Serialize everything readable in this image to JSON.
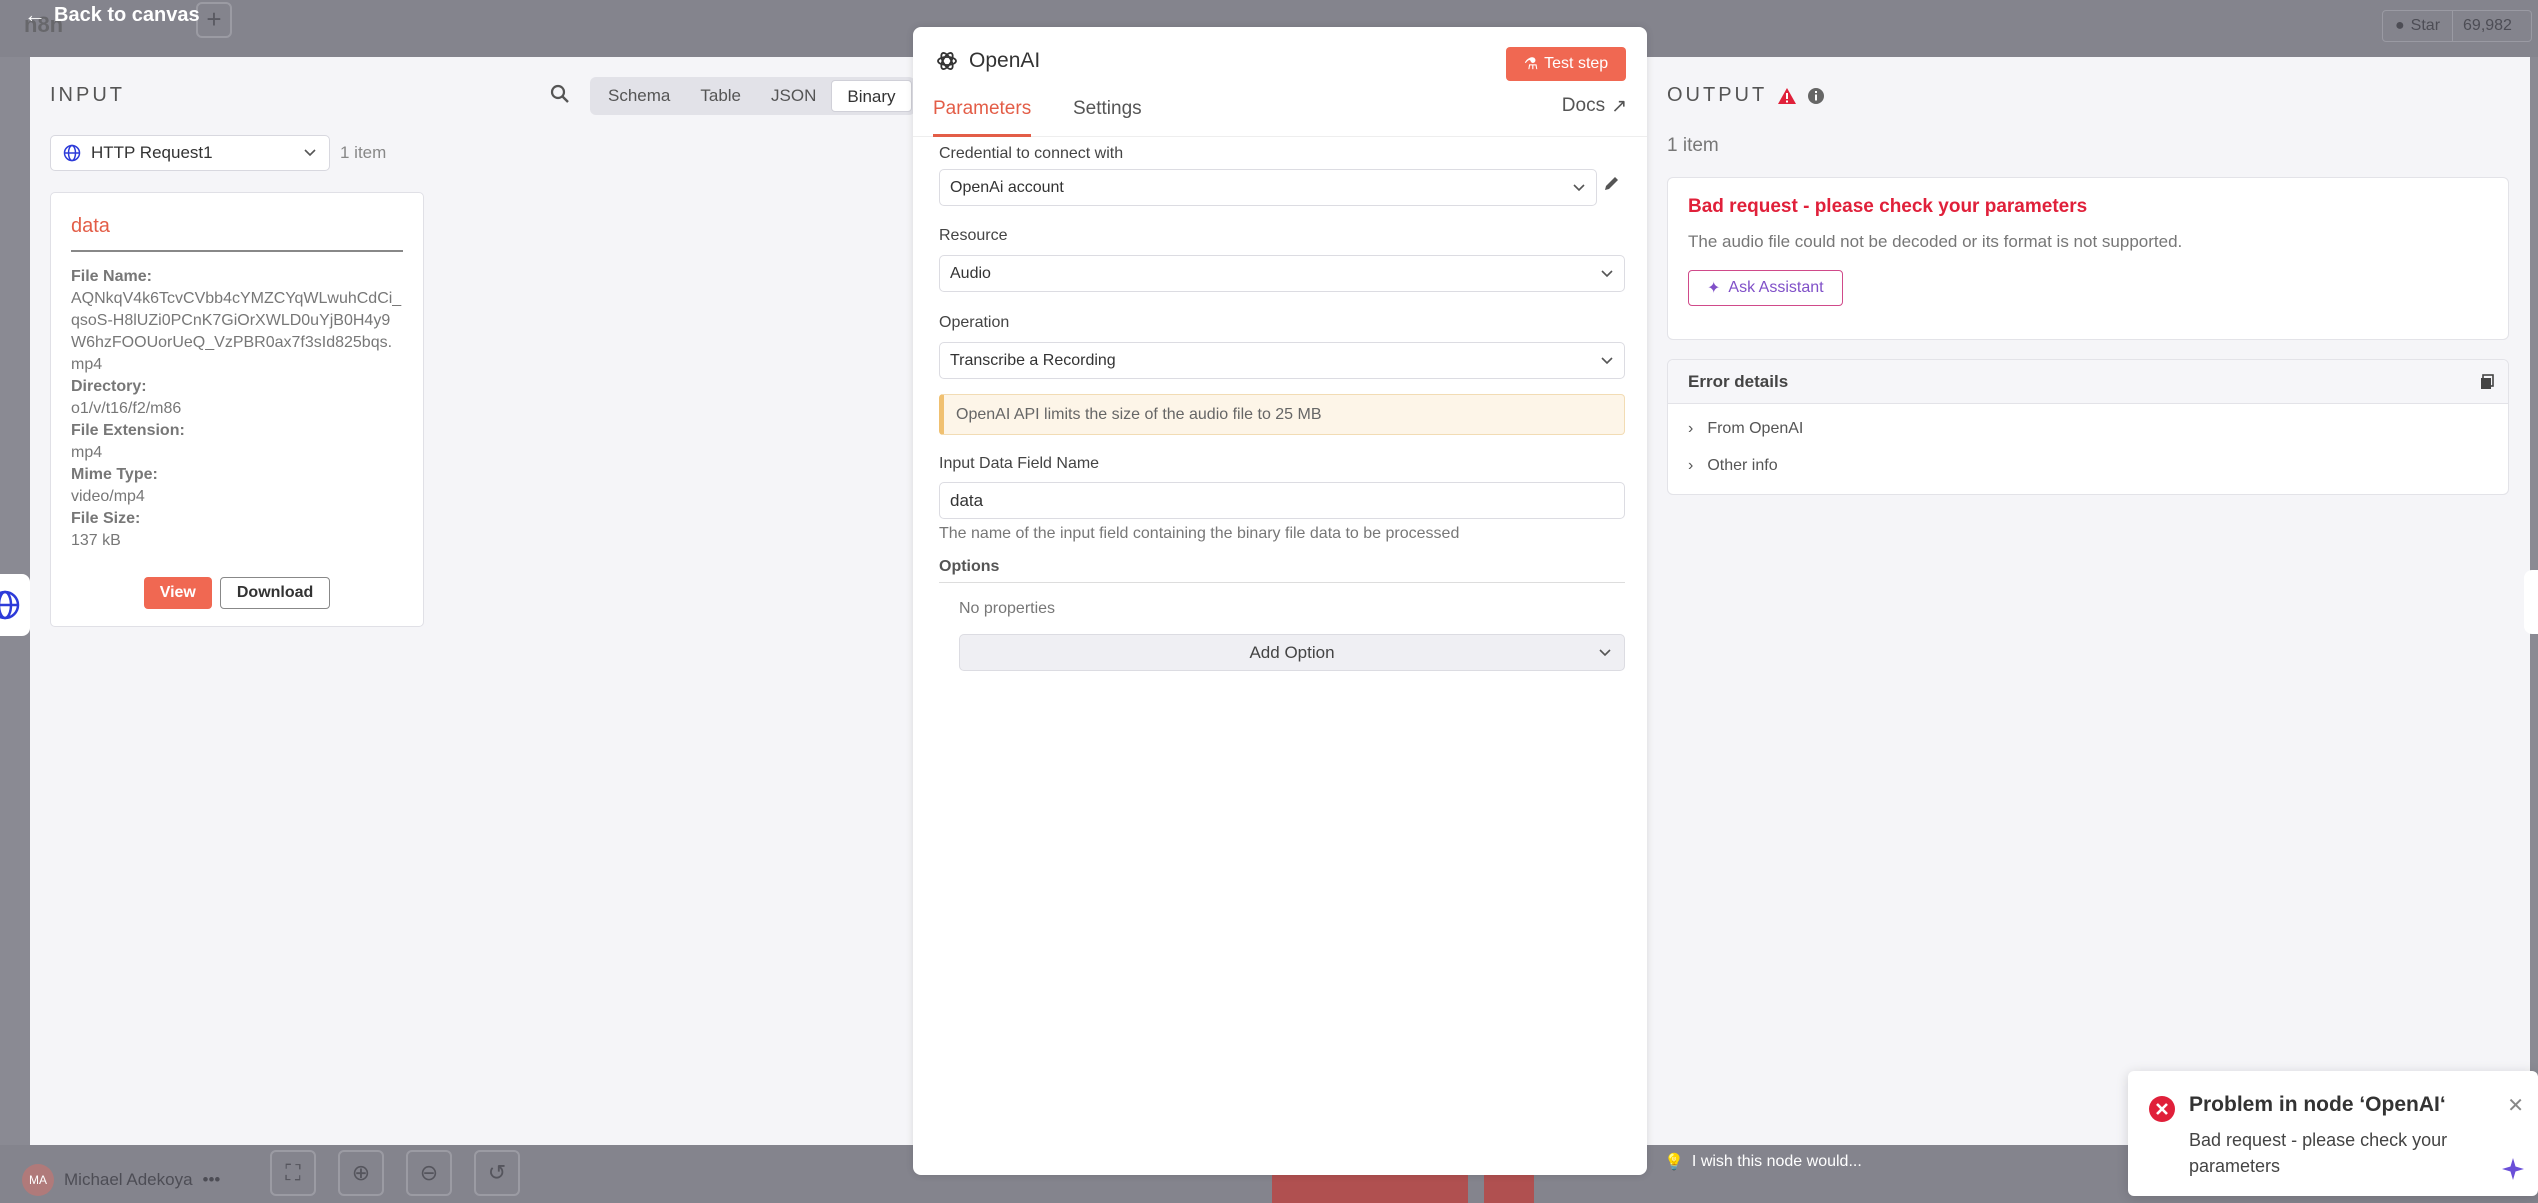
{
  "background": {
    "back_label": "Back to canvas",
    "logo": "n8n",
    "star_label": "Star",
    "star_count": "69,982",
    "user_initials": "MA",
    "user_name": "Michael Adekoya",
    "wish_text": "I wish this node would..."
  },
  "input": {
    "title": "INPUT",
    "tabs": [
      "Schema",
      "Table",
      "JSON",
      "Binary"
    ],
    "active_tab": "Binary",
    "node_name": "HTTP Request1",
    "item_count": "1 item",
    "card": {
      "title": "data",
      "fields": [
        {
          "label": "File Name:",
          "value": "AQNkqV4k6TcvCVbb4cYMZCYqWLwuhCdCi_qsoS-H8lUZi0PCnK7GiOrXWLD0uYjB0H4y9W6hzFOOUorUeQ_VzPBR0ax7f3sId825bqs.mp4"
        },
        {
          "label": "Directory:",
          "value": "o1/v/t16/f2/m86"
        },
        {
          "label": "File Extension:",
          "value": "mp4"
        },
        {
          "label": "Mime Type:",
          "value": "video/mp4"
        },
        {
          "label": "File Size:",
          "value": "137 kB"
        }
      ],
      "view_label": "View",
      "download_label": "Download"
    }
  },
  "node": {
    "title": "OpenAI",
    "test_label": "Test step",
    "tabs": {
      "parameters": "Parameters",
      "settings": "Settings",
      "docs": "Docs"
    },
    "credential_label": "Credential to connect with",
    "credential_value": "OpenAi account",
    "resource_label": "Resource",
    "resource_value": "Audio",
    "operation_label": "Operation",
    "operation_value": "Transcribe a Recording",
    "notice": "OpenAI API limits the size of the audio file to 25 MB",
    "field_label": "Input Data Field Name",
    "field_value": "data",
    "field_hint": "The name of the input field containing the binary file data to be processed",
    "options_title": "Options",
    "no_properties": "No properties",
    "add_option": "Add Option"
  },
  "output": {
    "title": "OUTPUT",
    "item_count": "1 item",
    "error_title": "Bad request - please check your parameters",
    "error_message": "The audio file could not be decoded or its format is not supported.",
    "ask_label": "Ask Assistant",
    "details_title": "Error details",
    "details_rows": [
      "From OpenAI",
      "Other info"
    ]
  },
  "toast": {
    "title": "Problem in node ‘OpenAI‘",
    "message": "Bad request - please check your parameters"
  },
  "colors": {
    "accent": "#f06852",
    "error": "#e0203a",
    "assistant": "#8050c8"
  }
}
